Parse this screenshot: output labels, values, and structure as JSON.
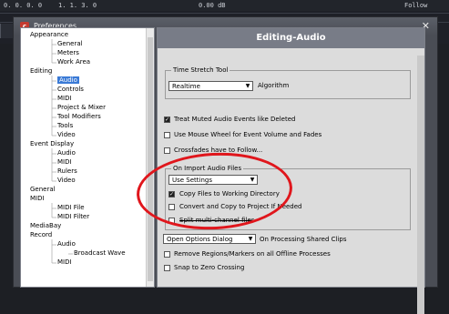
{
  "background": {
    "transport_text_left": "0. 0. 0. 0",
    "transport_text_mid": "1. 1. 3. 0",
    "transport_db": "0.00 dB",
    "transport_follow": "Follow",
    "bars": [
      "0",
      "0",
      "0",
      "0",
      "0",
      "0"
    ]
  },
  "window": {
    "title": "Preferences",
    "close_glyph": "✕"
  },
  "tree": {
    "items": [
      {
        "label": "Appearance",
        "level": 0
      },
      {
        "label": "General",
        "level": 1
      },
      {
        "label": "Meters",
        "level": 1
      },
      {
        "label": "Work Area",
        "level": 1
      },
      {
        "label": "Editing",
        "level": 0
      },
      {
        "label": "Audio",
        "level": 1,
        "selected": true
      },
      {
        "label": "Controls",
        "level": 1
      },
      {
        "label": "MIDI",
        "level": 1
      },
      {
        "label": "Project & Mixer",
        "level": 1
      },
      {
        "label": "Tool Modifiers",
        "level": 1
      },
      {
        "label": "Tools",
        "level": 1
      },
      {
        "label": "Video",
        "level": 1
      },
      {
        "label": "Event Display",
        "level": 0
      },
      {
        "label": "Audio",
        "level": 1
      },
      {
        "label": "MIDI",
        "level": 1
      },
      {
        "label": "Rulers",
        "level": 1
      },
      {
        "label": "Video",
        "level": 1
      },
      {
        "label": "General",
        "level": 0
      },
      {
        "label": "MIDI",
        "level": 0
      },
      {
        "label": "MIDI File",
        "level": 1
      },
      {
        "label": "MIDI Filter",
        "level": 1
      },
      {
        "label": "MediaBay",
        "level": 0
      },
      {
        "label": "Record",
        "level": 0
      },
      {
        "label": "Audio",
        "level": 1
      },
      {
        "label": "Broadcast Wave",
        "level": 2
      },
      {
        "label": "MIDI",
        "level": 1
      }
    ]
  },
  "panel": {
    "title": "Editing-Audio",
    "time_stretch": {
      "group_title": "Time Stretch Tool",
      "algorithm_value": "Realtime",
      "algorithm_label": "Algorithm"
    },
    "options": [
      {
        "label": "Treat Muted Audio Events like Deleted",
        "checked": true
      },
      {
        "label": "Use Mouse Wheel for Event Volume and Fades",
        "checked": false
      },
      {
        "label": "Crossfades have to Follow...",
        "checked": false
      }
    ],
    "import": {
      "group_title": "On Import Audio Files",
      "mode_value": "Use Settings",
      "copy_files": {
        "label": "Copy Files to Working Directory",
        "checked": true
      },
      "convert": {
        "label": "Convert and Copy to Project If Needed",
        "checked": false
      },
      "split": {
        "label": "Split multi-channel files",
        "checked": false
      }
    },
    "shared_clips": {
      "value": "Open Options Dialog",
      "label": "On Processing Shared Clips"
    },
    "bottom_options": [
      {
        "label": "Remove Regions/Markers on all Offline Processes",
        "checked": false
      },
      {
        "label": "Snap to Zero Crossing",
        "checked": false
      }
    ]
  }
}
